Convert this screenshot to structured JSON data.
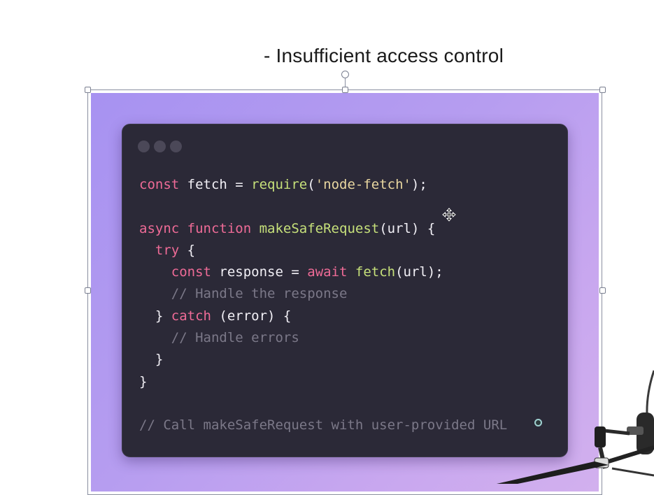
{
  "slide": {
    "title": "- Insufficient access control"
  },
  "code_window": {
    "lines": [
      [],
      [
        {
          "t": "const",
          "c": "kw"
        },
        {
          "t": " fetch = ",
          "c": "pl"
        },
        {
          "t": "require",
          "c": "fn"
        },
        {
          "t": "(",
          "c": "pl"
        },
        {
          "t": "'node-fetch'",
          "c": "str"
        },
        {
          "t": ");",
          "c": "pl"
        }
      ],
      [],
      [
        {
          "t": "async function",
          "c": "kw"
        },
        {
          "t": " ",
          "c": "pl"
        },
        {
          "t": "makeSafeRequest",
          "c": "fn"
        },
        {
          "t": "(url) {",
          "c": "pl"
        }
      ],
      [
        {
          "t": "  ",
          "c": "pl"
        },
        {
          "t": "try",
          "c": "kw"
        },
        {
          "t": " {",
          "c": "pl"
        }
      ],
      [
        {
          "t": "    ",
          "c": "pl"
        },
        {
          "t": "const",
          "c": "kw"
        },
        {
          "t": " response = ",
          "c": "pl"
        },
        {
          "t": "await",
          "c": "kw"
        },
        {
          "t": " ",
          "c": "pl"
        },
        {
          "t": "fetch",
          "c": "fn"
        },
        {
          "t": "(url);",
          "c": "pl"
        }
      ],
      [
        {
          "t": "    // Handle the response",
          "c": "cm"
        }
      ],
      [
        {
          "t": "  } ",
          "c": "pl"
        },
        {
          "t": "catch",
          "c": "kw"
        },
        {
          "t": " (error) {",
          "c": "pl"
        }
      ],
      [
        {
          "t": "    // Handle errors",
          "c": "cm"
        }
      ],
      [
        {
          "t": "  }",
          "c": "pl"
        }
      ],
      [
        {
          "t": "}",
          "c": "pl"
        }
      ],
      [],
      [
        {
          "t": "// Call makeSafeRequest with user-provided URL",
          "c": "cm"
        }
      ]
    ]
  },
  "icons": {
    "move_cursor": "move-cursor-icon",
    "text_caret": "text-caret-icon",
    "microphone": "microphone-icon"
  },
  "colors": {
    "keyword": "#ef6b97",
    "function": "#c6e07a",
    "string": "#e8d6a0",
    "comment": "#7b7888",
    "window_bg": "#2b2937"
  }
}
